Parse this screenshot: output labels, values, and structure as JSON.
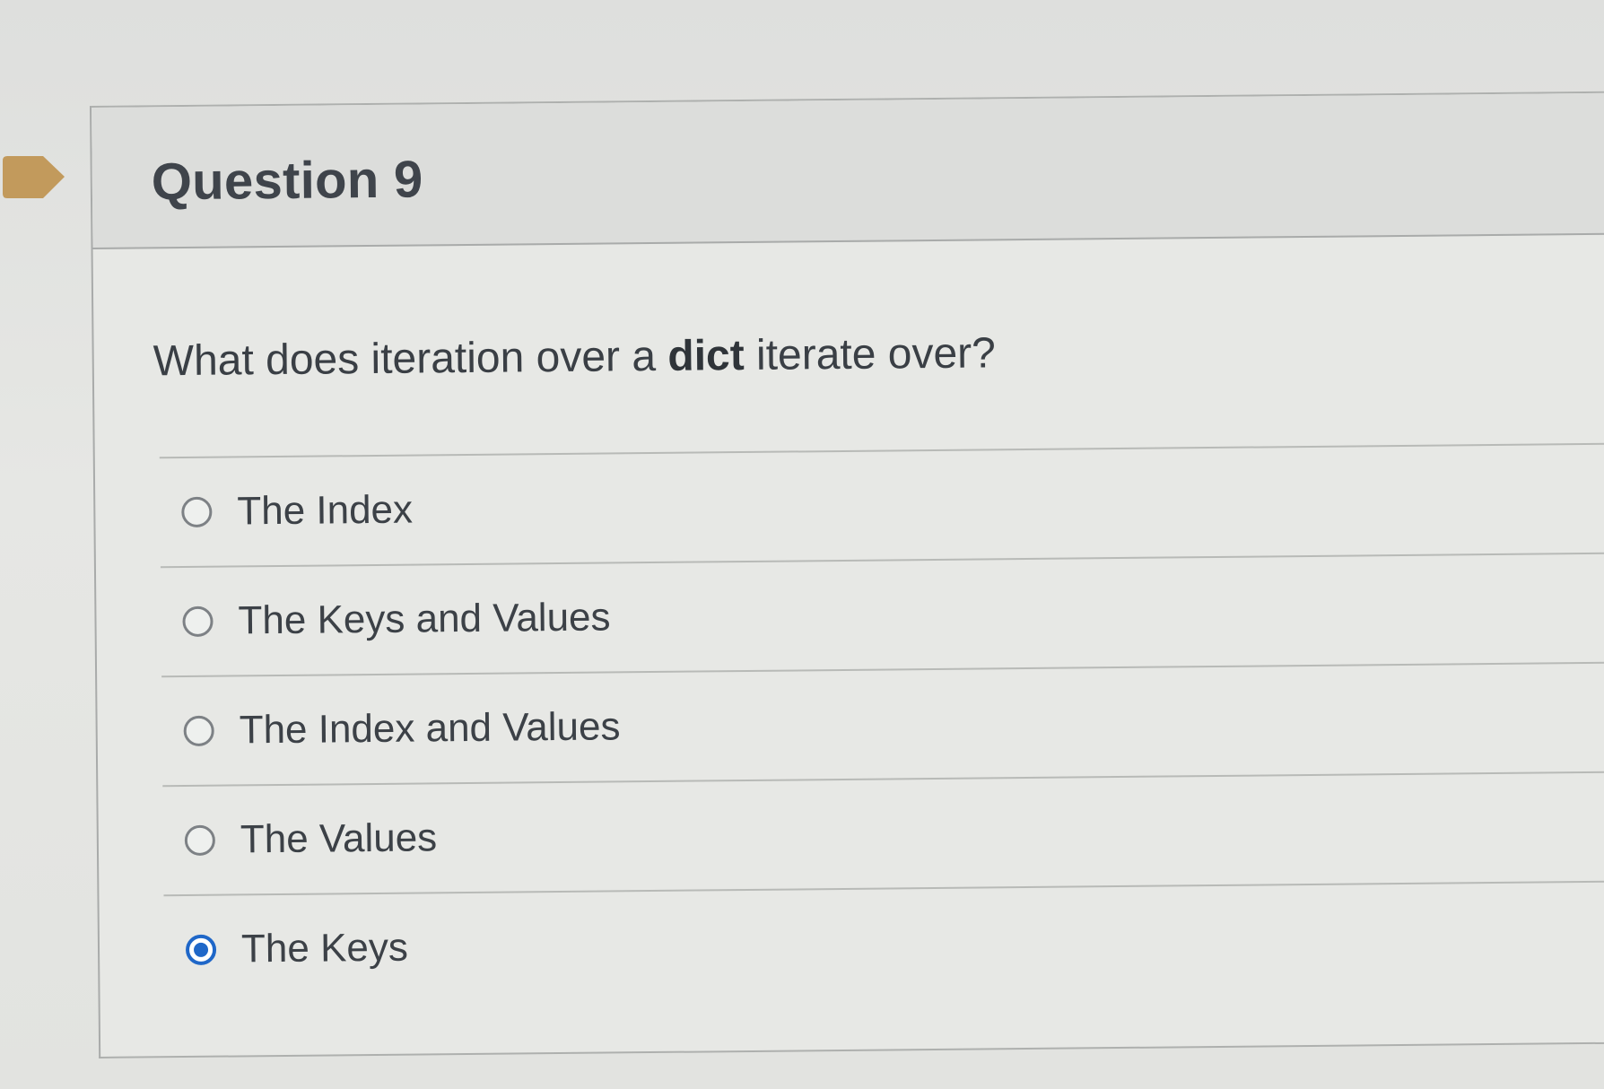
{
  "question": {
    "title": "Question 9",
    "text_before": "What does iteration over a ",
    "text_bold": "dict",
    "text_after": " iterate over?"
  },
  "answers": [
    {
      "label": "The Index",
      "selected": false
    },
    {
      "label": "The Keys and Values",
      "selected": false
    },
    {
      "label": "The Index and Values",
      "selected": false
    },
    {
      "label": "The Values",
      "selected": false
    },
    {
      "label": "The Keys",
      "selected": true
    }
  ],
  "colors": {
    "flag": "#c29a5c",
    "selected_radio": "#1f67c8",
    "card_background": "#e7e8e5",
    "page_background": "#e2e3e1",
    "text": "#3a3f45"
  },
  "icons": {
    "question_flag": "bookmark-flag-icon"
  }
}
